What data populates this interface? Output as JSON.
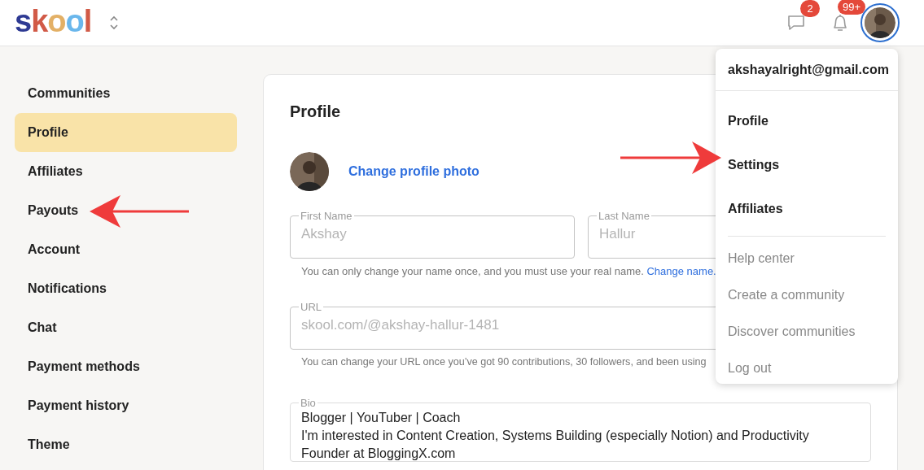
{
  "header": {
    "logo": "skool",
    "message_badge": "2",
    "notification_badge": "99+"
  },
  "sidebar": {
    "items": [
      {
        "label": "Communities",
        "selected": false
      },
      {
        "label": "Profile",
        "selected": true
      },
      {
        "label": "Affiliates",
        "selected": false
      },
      {
        "label": "Payouts",
        "selected": false
      },
      {
        "label": "Account",
        "selected": false
      },
      {
        "label": "Notifications",
        "selected": false
      },
      {
        "label": "Chat",
        "selected": false
      },
      {
        "label": "Payment methods",
        "selected": false
      },
      {
        "label": "Payment history",
        "selected": false
      },
      {
        "label": "Theme",
        "selected": false
      }
    ]
  },
  "profile": {
    "title": "Profile",
    "change_photo": "Change profile photo",
    "first_name": {
      "label": "First Name",
      "value": "Akshay",
      "disabled": true
    },
    "last_name": {
      "label": "Last Name",
      "value": "Hallur",
      "disabled": true
    },
    "name_hint": "You can only change your name once, and you must use your real name.",
    "name_hint_link": "Change name.",
    "url": {
      "label": "URL",
      "value": "skool.com/@akshay-hallur-1481",
      "disabled": true
    },
    "url_hint": "You can change your URL once you’ve got 90 contributions, 30 followers, and been using",
    "bio": {
      "label": "Bio",
      "lines": [
        "Blogger | YouTuber | Coach",
        "I'm interested in Content Creation, Systems Building (especially Notion) and Productivity",
        "Founder at BloggingX.com"
      ]
    }
  },
  "menu": {
    "email": "akshayalright@gmail.com",
    "items": [
      {
        "label": "Profile",
        "kind": "primary"
      },
      {
        "label": "Settings",
        "kind": "primary"
      },
      {
        "label": "Affiliates",
        "kind": "primary"
      },
      {
        "label": "Help center",
        "kind": "secondary"
      },
      {
        "label": "Create a community",
        "kind": "secondary"
      },
      {
        "label": "Discover communities",
        "kind": "secondary"
      },
      {
        "label": "Log out",
        "kind": "secondary"
      }
    ]
  }
}
